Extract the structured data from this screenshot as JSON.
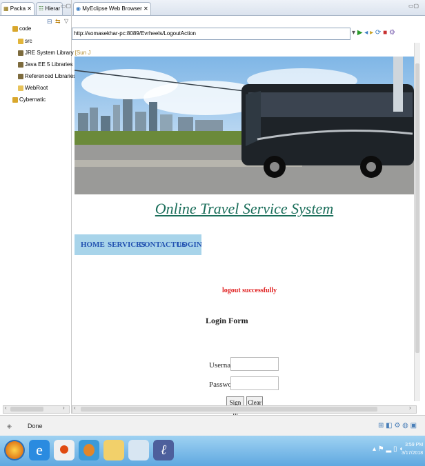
{
  "left_panel": {
    "tabs": [
      {
        "label": "Packa"
      },
      {
        "label": "Hierar"
      }
    ],
    "tree": [
      {
        "label": "code"
      },
      {
        "label": "src"
      },
      {
        "label": "JRE System Library",
        "suffix": "[Sun J"
      },
      {
        "label": "Java EE 5 Libraries"
      },
      {
        "label": "Referenced Libraries"
      },
      {
        "label": "WebRoot"
      },
      {
        "label": "Cybernatic"
      }
    ]
  },
  "browser": {
    "tab_label": "MyEclipse Web Browser",
    "address": "http://somasekhar-pc:8089/Evrheels/LogoutAction"
  },
  "page": {
    "site_title": "Online Travel Service System",
    "nav": [
      "HOME",
      "SERVICES",
      "CONTACTUS",
      "LOGIN"
    ],
    "message": "logout successfully",
    "form_title": "Login Form",
    "username_label": "Username",
    "password_label": "Password",
    "signin_label": "Sign In",
    "clear_label": "Clear"
  },
  "status": {
    "text": "Done"
  },
  "taskbar": {
    "time": "3:59 PM",
    "date": "3/17/2018"
  },
  "colors": {
    "nav_bg": "#a8d4ea",
    "nav_text": "#2050b0",
    "message": "#e02020",
    "title": "#1a6e5a"
  }
}
